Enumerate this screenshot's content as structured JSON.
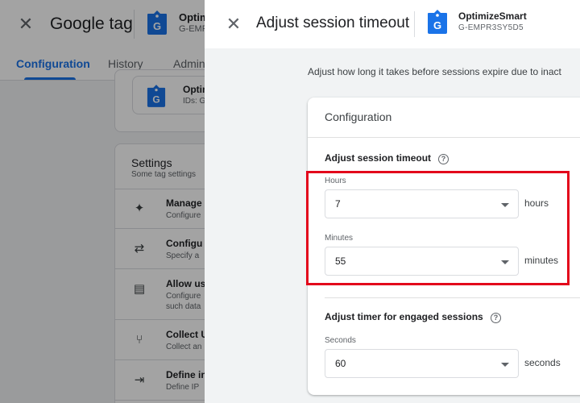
{
  "background": {
    "header": {
      "title": "Google tag",
      "tag_name": "Optim",
      "tag_id": "G-EMPR"
    },
    "tabs": [
      {
        "label": "Configuration"
      },
      {
        "label": "History"
      },
      {
        "label": "Admin"
      }
    ],
    "linked_tag": {
      "name": "Optim",
      "id": "IDs: G"
    },
    "settings": {
      "title": "Settings",
      "subtitle": "Some tag settings",
      "rows": [
        {
          "icon": "sparkle-icon",
          "title": "Manage",
          "sub": "Configure"
        },
        {
          "icon": "arrows-merge-icon",
          "title": "Configu",
          "sub": "Specify a"
        },
        {
          "icon": "user-data-icon",
          "title": "Allow us",
          "sub": "Configure such data"
        },
        {
          "icon": "fork-icon",
          "title": "Collect U",
          "sub": "Collect an"
        },
        {
          "icon": "login-icon",
          "title": "Define in",
          "sub": "Define IP"
        }
      ]
    }
  },
  "panel": {
    "title": "Adjust session timeout",
    "tag_name": "OptimizeSmart",
    "tag_id": "G-EMPR3SY5D5",
    "description": "Adjust how long it takes before sessions expire due to inact",
    "card": {
      "title": "Configuration",
      "session_section": {
        "title": "Adjust session timeout",
        "hours": {
          "label": "Hours",
          "value": "7",
          "unit": "hours"
        },
        "minutes": {
          "label": "Minutes",
          "value": "55",
          "unit": "minutes"
        }
      },
      "engaged_section": {
        "title": "Adjust timer for engaged sessions",
        "seconds": {
          "label": "Seconds",
          "value": "60",
          "unit": "seconds"
        }
      }
    }
  },
  "colors": {
    "accent": "#1a73e8",
    "highlight": "#e3061b",
    "tag_icon": "#1a73e8"
  }
}
